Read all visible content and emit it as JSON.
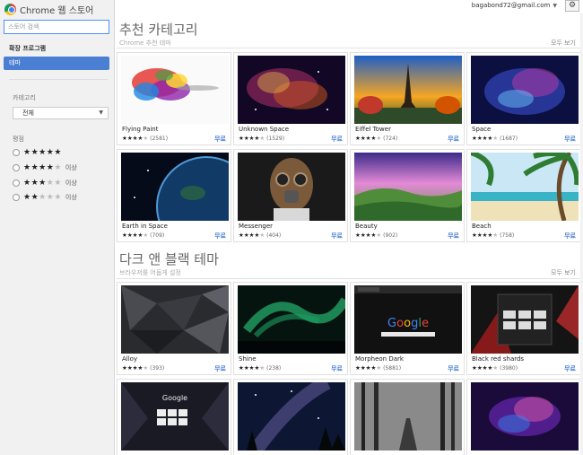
{
  "app": {
    "title": "Chrome 웹 스토어"
  },
  "search": {
    "placeholder": "스토어 검색"
  },
  "nav": {
    "extensions": "확장 프로그램",
    "themes": "테마"
  },
  "filters": {
    "category_label": "카테고리",
    "category_value": "전체",
    "rating_label": "평점",
    "ratings": [
      {
        "stars": 5,
        "suffix": ""
      },
      {
        "stars": 4,
        "suffix": "이상"
      },
      {
        "stars": 3,
        "suffix": "이상"
      },
      {
        "stars": 2,
        "suffix": "이상"
      }
    ]
  },
  "account": {
    "email": "bagabond72@gmail.com"
  },
  "sections": [
    {
      "title": "추천 카테고리",
      "subtitle": "Chrome 추천 테마",
      "view_all": "모두 보기",
      "tiles": [
        {
          "name": "Flying Paint",
          "rating": 4,
          "count": "(2581)",
          "price": "무료",
          "image": "colorful-ink-splash"
        },
        {
          "name": "Unknown Space",
          "rating": 4,
          "count": "(1529)",
          "price": "무료",
          "image": "nebula-space"
        },
        {
          "name": "Eiffel Tower",
          "rating": 4,
          "count": "(724)",
          "price": "무료",
          "image": "eiffel-tower-sunset"
        },
        {
          "name": "Space",
          "rating": 4,
          "count": "(1687)",
          "price": "무료",
          "image": "blue-space-nebula"
        },
        {
          "name": "Earth in Space",
          "rating": 4,
          "count": "(709)",
          "price": "무료",
          "image": "earth-from-space"
        },
        {
          "name": "Messenger",
          "rating": 4,
          "count": "(404)",
          "price": "무료",
          "image": "gas-mask-man"
        },
        {
          "name": "Beauty",
          "rating": 4,
          "count": "(902)",
          "price": "무료",
          "image": "green-valley"
        },
        {
          "name": "Beach",
          "rating": 4,
          "count": "(758)",
          "price": "무료",
          "image": "tropical-beach"
        }
      ]
    },
    {
      "title": "다크 앤 블랙 테마",
      "subtitle": "브라우저를 어둡게 설정",
      "view_all": "모두 보기",
      "tiles": [
        {
          "name": "Alloy",
          "rating": 4,
          "count": "(393)",
          "price": "무료",
          "image": "dark-polygons"
        },
        {
          "name": "Shine",
          "rating": 4,
          "count": "(238)",
          "price": "무료",
          "image": "aurora-night"
        },
        {
          "name": "Morpheon Dark",
          "rating": 4,
          "count": "(5881)",
          "price": "무료",
          "image": "dark-browser-google"
        },
        {
          "name": "Black red shards",
          "rating": 4,
          "count": "(3980)",
          "price": "무료",
          "image": "black-red-shards"
        },
        {
          "name": "",
          "rating": 0,
          "count": "",
          "price": "",
          "image": "dark-google-newtab"
        },
        {
          "name": "",
          "rating": 0,
          "count": "",
          "price": "",
          "image": "milky-way-trees"
        },
        {
          "name": "",
          "rating": 0,
          "count": "",
          "price": "",
          "image": "foggy-forest-road"
        },
        {
          "name": "",
          "rating": 0,
          "count": "",
          "price": "",
          "image": "purple-galaxy"
        }
      ]
    }
  ],
  "colors": {
    "accent": "#4a7fd3",
    "sidebar": "#f1f1f1",
    "price": "#4a7fd3"
  }
}
